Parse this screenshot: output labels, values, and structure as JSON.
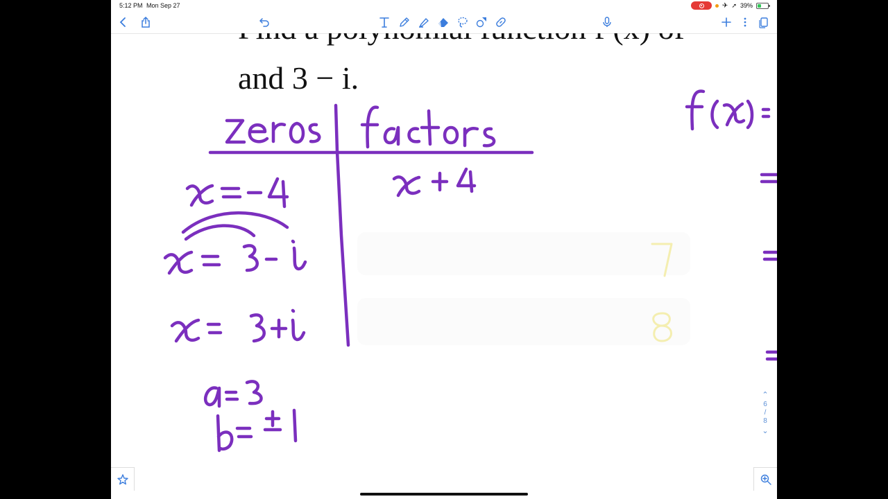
{
  "status_bar": {
    "time": "5:12 PM",
    "date": "Mon Sep 27",
    "battery_percent": "39%",
    "battery_level": 0.39
  },
  "toolbar": {
    "left_icons": [
      "back-icon",
      "share-icon"
    ],
    "center_icons": [
      "undo-icon",
      "text-tool-icon",
      "pen-icon",
      "highlighter-icon",
      "eraser-icon",
      "lasso-icon",
      "shape-icon",
      "link-icon",
      "microphone-icon"
    ],
    "right_icons": [
      "add-icon",
      "more-icon",
      "pages-icon"
    ]
  },
  "document": {
    "question_line_1": "Find a polynomial function f (x) of",
    "question_line_2": "and 3 − i.",
    "table": {
      "col1_header": "zeros",
      "col2_header": "factors",
      "rows": [
        {
          "zero": "x = -4",
          "factor": "x + 4"
        },
        {
          "zero": "x = 3 - i",
          "factor": ""
        },
        {
          "zero": "x = 3+i",
          "factor": ""
        }
      ]
    },
    "notes": [
      "a = 3",
      "b = ±1"
    ],
    "right_work": [
      "f(x) ="
    ],
    "faint_marks": [
      "7",
      "8"
    ]
  },
  "page_nav": {
    "current": "6",
    "separator": "/",
    "total": "8"
  },
  "colors": {
    "ink": "#7b2fbe",
    "accent": "#5b8fd6",
    "faint_mark": "#f4eeb0",
    "recording": "#e53935",
    "battery": "#34c759"
  }
}
